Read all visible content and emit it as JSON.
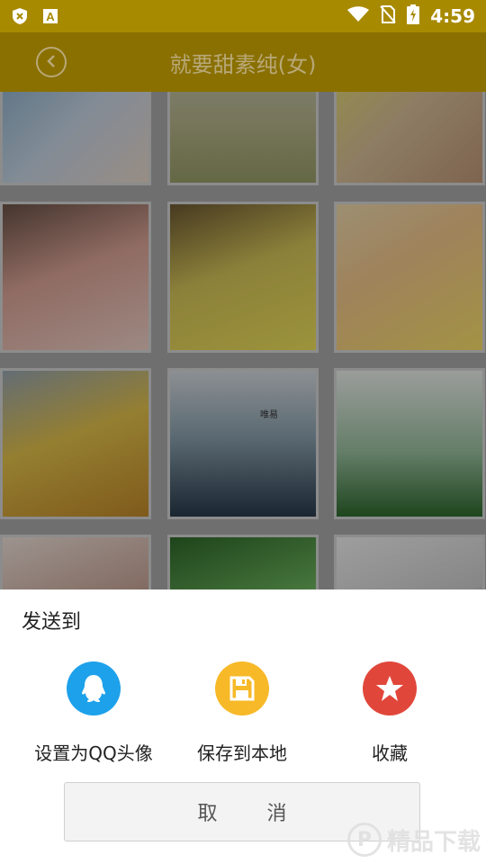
{
  "status_bar": {
    "time": "4:59",
    "left_icons": [
      "shield-icon",
      "font-a-icon"
    ],
    "right_icons": [
      "wifi-icon",
      "no-sim-icon",
      "battery-charging-icon"
    ]
  },
  "app_bar": {
    "title": "就要甜素纯(女)",
    "back_icon": "chevron-left-icon"
  },
  "gallery": {
    "overlay_text": "唯易"
  },
  "share_sheet": {
    "title": "发送到",
    "actions": [
      {
        "label": "设置为QQ头像",
        "icon": "qq-penguin-icon",
        "color": "#1da1ea"
      },
      {
        "label": "保存到本地",
        "icon": "save-disk-icon",
        "color": "#f7b928"
      },
      {
        "label": "收藏",
        "icon": "star-icon",
        "color": "#e0473a"
      }
    ],
    "cancel_label": "取 消"
  },
  "watermark": {
    "text": "精品下载"
  }
}
